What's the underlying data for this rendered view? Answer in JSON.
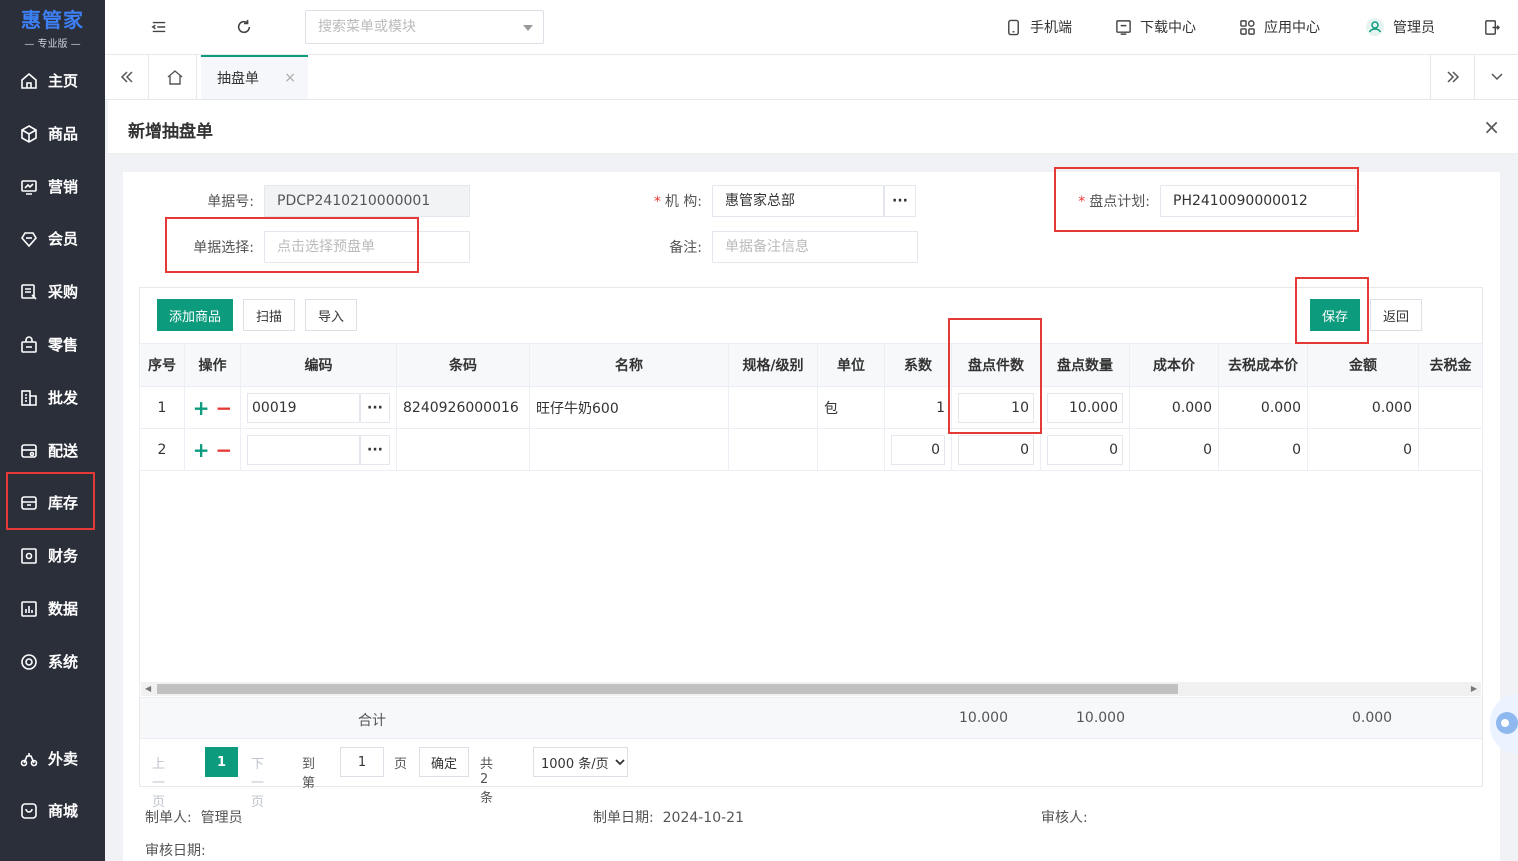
{
  "app": {
    "logo": "惠管家",
    "edition": "专业版"
  },
  "sidebar": {
    "items": [
      {
        "label": "主页",
        "icon": "home-icon"
      },
      {
        "label": "商品",
        "icon": "box-icon"
      },
      {
        "label": "营销",
        "icon": "marketing-icon"
      },
      {
        "label": "会员",
        "icon": "member-icon"
      },
      {
        "label": "采购",
        "icon": "purchase-icon"
      },
      {
        "label": "零售",
        "icon": "retail-icon"
      },
      {
        "label": "批发",
        "icon": "wholesale-icon"
      },
      {
        "label": "配送",
        "icon": "delivery-icon"
      },
      {
        "label": "库存",
        "icon": "inventory-icon"
      },
      {
        "label": "财务",
        "icon": "finance-icon"
      },
      {
        "label": "数据",
        "icon": "data-icon"
      },
      {
        "label": "系统",
        "icon": "system-icon"
      },
      {
        "label": "外卖",
        "icon": "takeout-icon"
      },
      {
        "label": "商城",
        "icon": "mall-icon"
      }
    ]
  },
  "header": {
    "search_placeholder": "搜索菜单或模块",
    "mobile": "手机端",
    "download": "下载中心",
    "apps": "应用中心",
    "user": "管理员"
  },
  "tabs": {
    "active": "抽盘单",
    "close": "×"
  },
  "page": {
    "title": "新增抽盘单",
    "close": "×"
  },
  "form": {
    "doc_no_label": "单据号:",
    "doc_no": "PDCP2410210000001",
    "org_label": "机 构:",
    "org": "惠管家总部",
    "plan_label": "盘点计划:",
    "plan": "PH2410090000012",
    "select_label": "单据选择:",
    "select_placeholder": "点击选择预盘单",
    "remark_label": "备注:",
    "remark_placeholder": "单据备注信息",
    "required_mark": "*",
    "dots": "···"
  },
  "toolbar": {
    "add": "添加商品",
    "scan": "扫描",
    "import": "导入",
    "save": "保存",
    "back": "返回"
  },
  "grid": {
    "columns": [
      "序号",
      "操作",
      "编码",
      "条码",
      "名称",
      "规格/级别",
      "单位",
      "系数",
      "盘点件数",
      "盘点数量",
      "成本价",
      "去税成本价",
      "金额",
      "去税金"
    ],
    "rows": [
      {
        "seq": "1",
        "code": "00019",
        "barcode": "8240926000016",
        "name": "旺仔牛奶600",
        "spec": "",
        "unit": "包",
        "factor": "1",
        "count_pieces": "10",
        "count_qty": "10.000",
        "cost": "0.000",
        "cost_notax": "0.000",
        "amount": "0.000"
      },
      {
        "seq": "2",
        "code": "",
        "barcode": "",
        "name": "",
        "spec": "",
        "unit": "",
        "factor": "0",
        "count_pieces": "0",
        "count_qty": "0",
        "cost": "0",
        "cost_notax": "0",
        "amount": "0"
      }
    ],
    "summary_label": "合计",
    "summary_pieces": "10.000",
    "summary_qty": "10.000",
    "summary_amount": "0.000"
  },
  "pager": {
    "prev": "上一页",
    "current": "1",
    "next": "下一页",
    "goto": "到第",
    "goto_value": "1",
    "page_unit": "页",
    "confirm": "确定",
    "total": "共 2 条",
    "page_size": "1000 条/页"
  },
  "footer": {
    "maker_label": "制单人:",
    "maker": "管理员",
    "date_label": "制单日期:",
    "date": "2024-10-21",
    "auditor_label": "审核人:",
    "audit_date_label": "审核日期:"
  },
  "colors": {
    "primary": "#0d9b7e",
    "sidebar": "#2b2f3a",
    "highlight": "#e53935",
    "logo": "#3d7ff5"
  }
}
